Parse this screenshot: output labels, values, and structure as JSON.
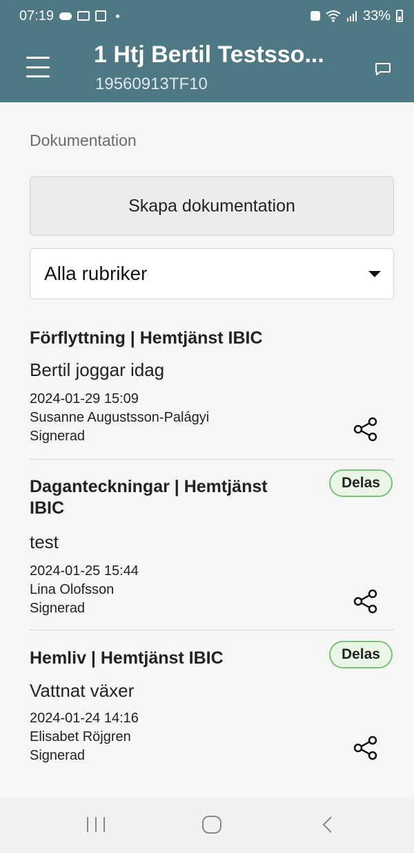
{
  "status_bar": {
    "time": "07:19",
    "battery": "33%"
  },
  "header": {
    "title": "1 Htj Bertil Testsso...",
    "subtitle": "19560913TF10"
  },
  "section_label": "Dokumentation",
  "create_button_label": "Skapa dokumentation",
  "filter": {
    "selected": "Alla rubriker"
  },
  "entries": [
    {
      "heading": "Förflyttning  |  Hemtjänst IBIC",
      "text": "Bertil joggar idag",
      "date": "2024-01-29 15:09",
      "author": "Susanne Augustsson-Palágyi",
      "status": "Signerad"
    },
    {
      "heading": "Daganteckningar  |  Hemtjänst IBIC",
      "badge": "Delas",
      "text": "test",
      "date": "2024-01-25 15:44",
      "author": "Lina Olofsson",
      "status": "Signerad"
    },
    {
      "heading": "Hemliv  |  Hemtjänst IBIC",
      "badge": "Delas",
      "text": "Vattnat växer",
      "date": "2024-01-24 14:16",
      "author": "Elisabet Röjgren",
      "status": "Signerad"
    }
  ],
  "colors": {
    "header_bg": "#4d7884",
    "badge_border": "#7ac07a",
    "badge_bg": "#e9f6e6"
  }
}
